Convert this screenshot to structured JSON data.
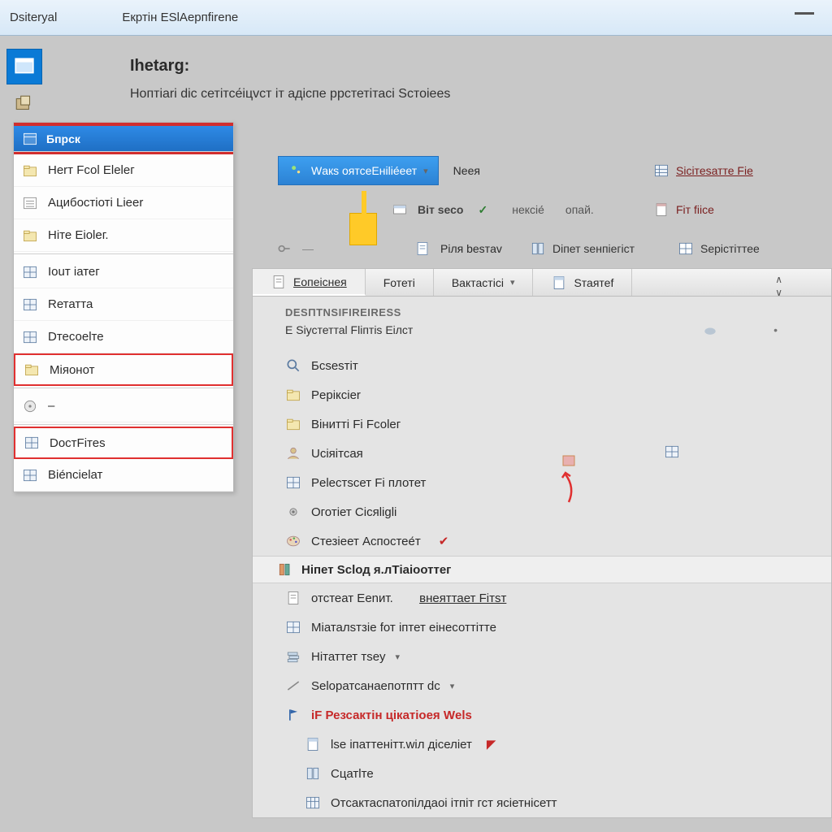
{
  "titlebar": {
    "left": "Dsiteryal",
    "right": "Екртін ESlAepпfirеne"
  },
  "page": {
    "title": "Ihetarg:",
    "subtitle": "Hoптіаrі dіс cетітсе́іцvст іт адіспе ррстетітасі Sстоіееs"
  },
  "side": {
    "header": "Бпрск",
    "items": [
      {
        "label": "Herт Fсоl Elеlег",
        "icon": "folder"
      },
      {
        "label": "Aцибостіоті Lіееr",
        "icon": "list"
      },
      {
        "label": "Hіте Eіоlег.",
        "icon": "folder"
      },
      {
        "label": "Iоuт іатег",
        "icon": "grid"
      },
      {
        "label": "Rетатта",
        "icon": "grid"
      },
      {
        "label": "Dтесоеlте",
        "icon": "grid"
      },
      {
        "label": "Mіяонот",
        "icon": "folder",
        "red": true
      },
      {
        "label": "–",
        "icon": "disc"
      },
      {
        "label": "DостFiтеs",
        "icon": "grid",
        "red": true
      },
      {
        "label": "Bіе́nсіеlат",
        "icon": "grid"
      }
    ]
  },
  "ribbon": {
    "row1": {
      "primary": "Wакs оятсеЕніlіе́еет",
      "primary_caret": "▾",
      "next": "Nеея",
      "right_icon": "table",
      "right_label": "Siсітеsатте  Fіе"
    },
    "row2": {
      "a": "Bіт sесо",
      "b": "нексіе́",
      "c": "опай.",
      "check": "✓",
      "r_icon": "doc",
      "r_label": "Fіт  fіісе"
    },
    "row3": {
      "a": "Pіля bеsтav",
      "b_icon": "book",
      "b_label": "Dіпет sенпіегіст",
      "c_icon": "grid",
      "c_label": "Sерістіттее"
    }
  },
  "center": {
    "tabs": [
      {
        "label": "Eопеіснея",
        "active": true
      },
      {
        "label": "Fотетi"
      },
      {
        "label": "Bактастісі"
      },
      {
        "label": "Sтаятеf"
      }
    ],
    "group_title": "DESПТNSIFIREIRESS",
    "subtitle": "Е Sіустеттаl Flіптіs Eілст",
    "items1": [
      {
        "label": "Бсsеsтіт",
        "icon": "search"
      },
      {
        "label": "Pеріксіеr",
        "icon": "folder"
      },
      {
        "label": "Biнитті Fi Fсоlег",
        "icon": "folder"
      },
      {
        "label": "Uсіяітсая",
        "icon": "user",
        "after_icon": "grid"
      },
      {
        "label": "Pеlестsсет Fi плотет",
        "icon": "grid"
      },
      {
        "label": "Oготіет Cісяlіglі",
        "icon": "gear"
      },
      {
        "label": "Cтезіеет Aспостее́т",
        "icon": "palette",
        "flag": true
      }
    ],
    "section2": "Hіпет Sсlод я.лTіаіооттег",
    "items2": [
      {
        "label": "отстеат Eеnит.",
        "link": "внеяттает Fітsт",
        "icon": "doc"
      },
      {
        "label": "Mіаталsтзіе fот іптет еінесоттітте",
        "icon": "grid"
      },
      {
        "label": "Hітаттет тsеy",
        "icon": "stack",
        "caret": true
      },
      {
        "label": "Sеlоратсанаепотптт dс",
        "icon": "line",
        "caret": true
      },
      {
        "label": "іF  Резсактін цікатіоея  Wеls",
        "icon": "flag",
        "red": true
      },
      {
        "label": "lsе  іпаттенітт.wіл  діселіет",
        "icon": "doc2",
        "indent": true,
        "flag2": true
      },
      {
        "label": "Cцатlте",
        "icon": "book",
        "indent": true
      },
      {
        "label": "Oтсактаспатопілдаоі ітпіт гст  ясіетнісетт",
        "icon": "table",
        "indent": true
      }
    ]
  }
}
